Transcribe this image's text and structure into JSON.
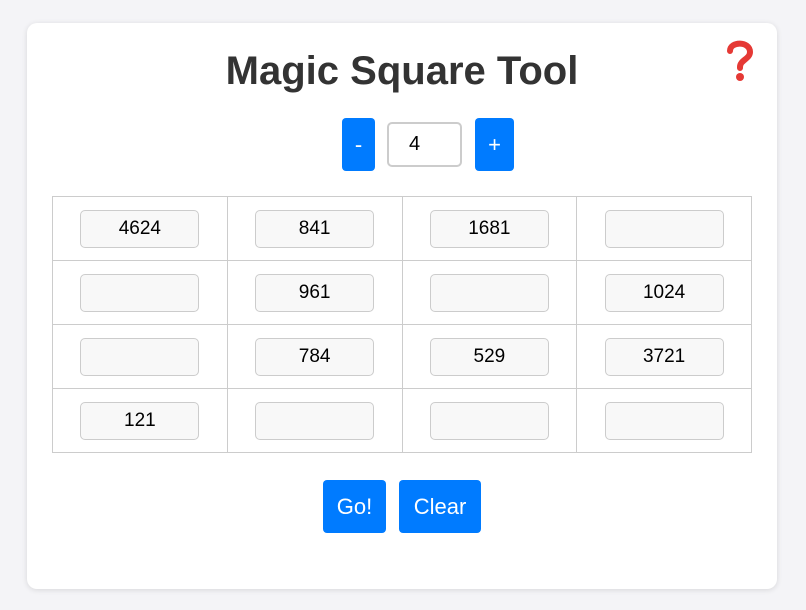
{
  "app": {
    "title": "Magic Square Tool"
  },
  "help": {
    "icon": "question-mark-icon",
    "color": "#e53935"
  },
  "size_controls": {
    "decrement_label": "-",
    "increment_label": "+",
    "size_value": "4"
  },
  "grid": {
    "rows": [
      [
        "4624",
        "841",
        "1681",
        ""
      ],
      [
        "",
        "961",
        "",
        "1024"
      ],
      [
        "",
        "784",
        "529",
        "3721"
      ],
      [
        "121",
        "",
        "",
        ""
      ]
    ]
  },
  "actions": {
    "go_label": "Go!",
    "clear_label": "Clear"
  },
  "colors": {
    "accent": "#007bff",
    "page_background": "#f4f4f7",
    "card_background": "#ffffff",
    "title_text": "#333333"
  }
}
